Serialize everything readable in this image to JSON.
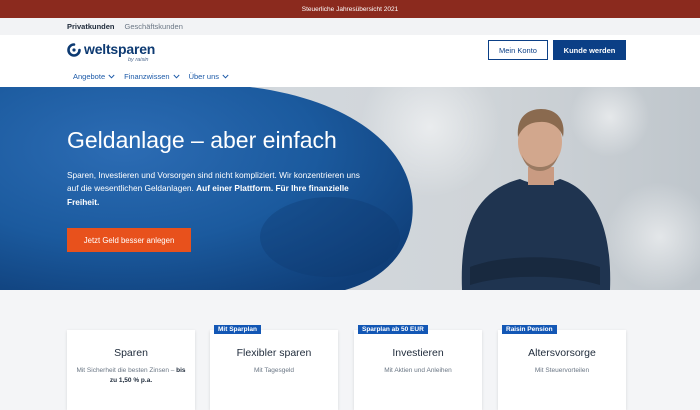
{
  "banner": {
    "text": "Steuerliche Jahresübersicht 2021"
  },
  "segments": {
    "private": "Privatkunden",
    "business": "Geschäftskunden"
  },
  "header": {
    "logo_text": "weltsparen",
    "logo_sub": "by raisin",
    "account_button": "Mein Konto",
    "signup_button": "Kunde werden"
  },
  "nav": {
    "items": [
      {
        "label": "Angebote",
        "icon": "chevron-down-icon"
      },
      {
        "label": "Finanzwissen",
        "icon": "chevron-down-icon"
      },
      {
        "label": "Über uns",
        "icon": "chevron-down-icon"
      }
    ]
  },
  "hero": {
    "title": "Geldanlage – aber einfach",
    "text_plain": "Sparen, Investieren und Vorsorgen sind nicht kompliziert. Wir konzentrieren uns auf die wesentlichen Geldanlagen. ",
    "text_bold": "Auf einer Plattform. Für Ihre finanzielle Freiheit.",
    "cta": "Jetzt Geld besser anlegen"
  },
  "cards": [
    {
      "badge": "",
      "title": "Sparen",
      "sub_plain": "Mit Sicherheit die besten Zinsen – ",
      "sub_bold": "bis zu 1,50 % p.a."
    },
    {
      "badge": "Mit Sparplan",
      "title": "Flexibler sparen",
      "sub_plain": "Mit Tagesgeld",
      "sub_bold": ""
    },
    {
      "badge": "Sparplan ab 50 EUR",
      "title": "Investieren",
      "sub_plain": "Mit Aktien und Anleihen",
      "sub_bold": ""
    },
    {
      "badge": "Raisin Pension",
      "title": "Altersvorsorge",
      "sub_plain": "Mit Steuervorteilen",
      "sub_bold": ""
    }
  ],
  "colors": {
    "banner_bg": "#8b2a1e",
    "brand_blue": "#0b3f86",
    "hero_blue": "#1b5a9e",
    "cta_orange": "#e8511c",
    "badge_blue": "#1357b5"
  }
}
